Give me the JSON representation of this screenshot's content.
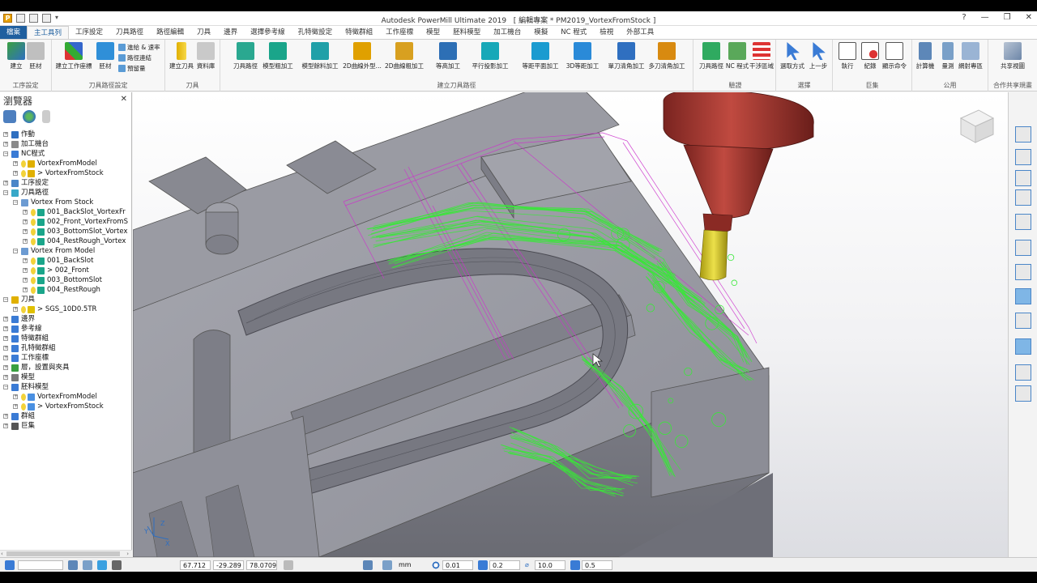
{
  "window": {
    "title": "Autodesk PowerMill Ultimate 2019",
    "project": "[ 編輯專案 * PM2019_VortexFromStock ]",
    "controls": [
      "?",
      "—",
      "❐",
      "✕"
    ]
  },
  "ribbon_tabs": [
    "檔案",
    "主工具列",
    "工序設定",
    "刀具路徑",
    "路徑編輯",
    "刀具",
    "邊界",
    "選擇參考線",
    "孔特徵設定",
    "特徵群組",
    "工作座標",
    "模型",
    "胚料模型",
    "加工機台",
    "模擬",
    "NC 程式",
    "檢視",
    "外部工具"
  ],
  "active_tab": "主工具列",
  "ribbon": {
    "groups": [
      {
        "label": "工序設定",
        "buttons": [
          "建立",
          "胚材"
        ]
      },
      {
        "label": "刀具路徑設定",
        "buttons": [
          "建立工作座標",
          "胚材"
        ],
        "small": [
          "進給 & 速率",
          "路徑連結",
          "預留量"
        ]
      },
      {
        "label": "刀具",
        "buttons": [
          "建立刀具",
          "資料庫"
        ]
      },
      {
        "label": "建立刀具路徑",
        "buttons": [
          "刀具路徑",
          "模型粗加工",
          "模型餘料加工",
          "2D曲線外型...",
          "2D曲線粗加工",
          "等高加工",
          "平行投影加工",
          "等距平面加工",
          "3D等距加工",
          "單刀清角加工",
          "多刀清角加工"
        ]
      },
      {
        "label": "驗證",
        "buttons": [
          "刀具路徑",
          "NC 程式",
          "干涉區域"
        ]
      },
      {
        "label": "選擇",
        "buttons": [
          "選取方式",
          "上一步"
        ]
      },
      {
        "label": "巨集",
        "buttons": [
          "執行",
          "紀錄",
          "顯示命令"
        ]
      },
      {
        "label": "公用",
        "buttons": [
          "計算機",
          "量測",
          "網射專區"
        ]
      },
      {
        "label": "合作共享規畫",
        "buttons": [
          "共享視圖"
        ]
      }
    ]
  },
  "browser": {
    "title": "瀏覽器",
    "close": "✕",
    "tree": [
      {
        "level": 0,
        "label": "作動",
        "icon": "activity-icon",
        "color": "#2f6fc0"
      },
      {
        "level": 0,
        "label": "加工機台",
        "icon": "machine-icon",
        "color": "#8a8a8a"
      },
      {
        "level": 0,
        "label": "NC程式",
        "icon": "nc-program-icon",
        "color": "#3a7bd5",
        "expanded": true
      },
      {
        "level": 1,
        "label": "VortexFromModel",
        "icon": "nc-file-icon",
        "color": "#e0b000"
      },
      {
        "level": 1,
        "label": "> VortexFromStock",
        "icon": "nc-file-icon",
        "color": "#e0b000"
      },
      {
        "level": 0,
        "label": "工序設定",
        "icon": "setup-icon",
        "color": "#4a86c8"
      },
      {
        "level": 0,
        "label": "刀具路徑",
        "icon": "toolpath-icon",
        "color": "#38a8c8",
        "expanded": true
      },
      {
        "level": 1,
        "label": "Vortex From Stock",
        "icon": "folder-icon",
        "color": "#6c9bd2",
        "expanded": true
      },
      {
        "level": 2,
        "label": "001_BackSlot_VortexFr",
        "icon": "toolpath-item-icon",
        "color": "#1aa58a"
      },
      {
        "level": 2,
        "label": "002_Front_VortexFromS",
        "icon": "toolpath-item-icon",
        "color": "#1aa58a"
      },
      {
        "level": 2,
        "label": "003_BottomSlot_Vortex",
        "icon": "toolpath-item-icon",
        "color": "#1aa58a"
      },
      {
        "level": 2,
        "label": "004_RestRough_Vortex",
        "icon": "toolpath-item-icon",
        "color": "#1aa58a"
      },
      {
        "level": 1,
        "label": "Vortex From Model",
        "icon": "folder-icon",
        "color": "#6c9bd2",
        "expanded": true
      },
      {
        "level": 2,
        "label": "001_BackSlot",
        "icon": "toolpath-item-icon",
        "color": "#1aa58a"
      },
      {
        "level": 2,
        "label": "> 002_Front",
        "icon": "toolpath-item-icon",
        "color": "#1aa58a"
      },
      {
        "level": 2,
        "label": "003_BottomSlot",
        "icon": "toolpath-item-icon",
        "color": "#1aa58a"
      },
      {
        "level": 2,
        "label": "004_RestRough",
        "icon": "toolpath-item-icon",
        "color": "#1aa58a"
      },
      {
        "level": 0,
        "label": "刀具",
        "icon": "tool-icon",
        "color": "#e0b000",
        "expanded": true
      },
      {
        "level": 1,
        "label": "> SGS_10D0.5TR",
        "icon": "tool-item-icon",
        "color": "#e0c000"
      },
      {
        "level": 0,
        "label": "邊界",
        "icon": "boundary-icon",
        "color": "#3a7bd5"
      },
      {
        "level": 0,
        "label": "參考線",
        "icon": "pattern-icon",
        "color": "#3a7bd5"
      },
      {
        "level": 0,
        "label": "特徵群組",
        "icon": "feature-group-icon",
        "color": "#3a7bd5"
      },
      {
        "level": 0,
        "label": "孔特徵群組",
        "icon": "hole-feature-icon",
        "color": "#3a7bd5"
      },
      {
        "level": 0,
        "label": "工作座標",
        "icon": "workplane-icon",
        "color": "#3a7bd5"
      },
      {
        "level": 0,
        "label": "層，設置與夾具",
        "icon": "layers-icon",
        "color": "#3aa040"
      },
      {
        "level": 0,
        "label": "模型",
        "icon": "model-icon",
        "color": "#7a7a7a"
      },
      {
        "level": 0,
        "label": "胚料模型",
        "icon": "stock-model-icon",
        "color": "#3a7bd5",
        "expanded": true
      },
      {
        "level": 1,
        "label": "VortexFromModel",
        "icon": "stock-item-icon",
        "color": "#4a90e2"
      },
      {
        "level": 1,
        "label": "> VortexFromStock",
        "icon": "stock-item-icon",
        "color": "#4a90e2"
      },
      {
        "level": 0,
        "label": "群組",
        "icon": "group-icon",
        "color": "#3a7bd5"
      },
      {
        "level": 0,
        "label": "巨集",
        "icon": "macro-icon",
        "color": "#555555"
      }
    ]
  },
  "status": {
    "x": "67.712",
    "y": "-29.289",
    "z": "78.0709",
    "units": "mm",
    "tolerance": "0.01",
    "thickness": "0.2",
    "diameter": "10.0",
    "stepover": "0.5"
  },
  "colors": {
    "accent": "#1f5f9f",
    "toolpath_green": "#38e838",
    "link_magenta": "#cc33cc",
    "holder_red": "#a83830",
    "tool_yellow": "#e0d020",
    "model_gray": "#8e8e96"
  }
}
